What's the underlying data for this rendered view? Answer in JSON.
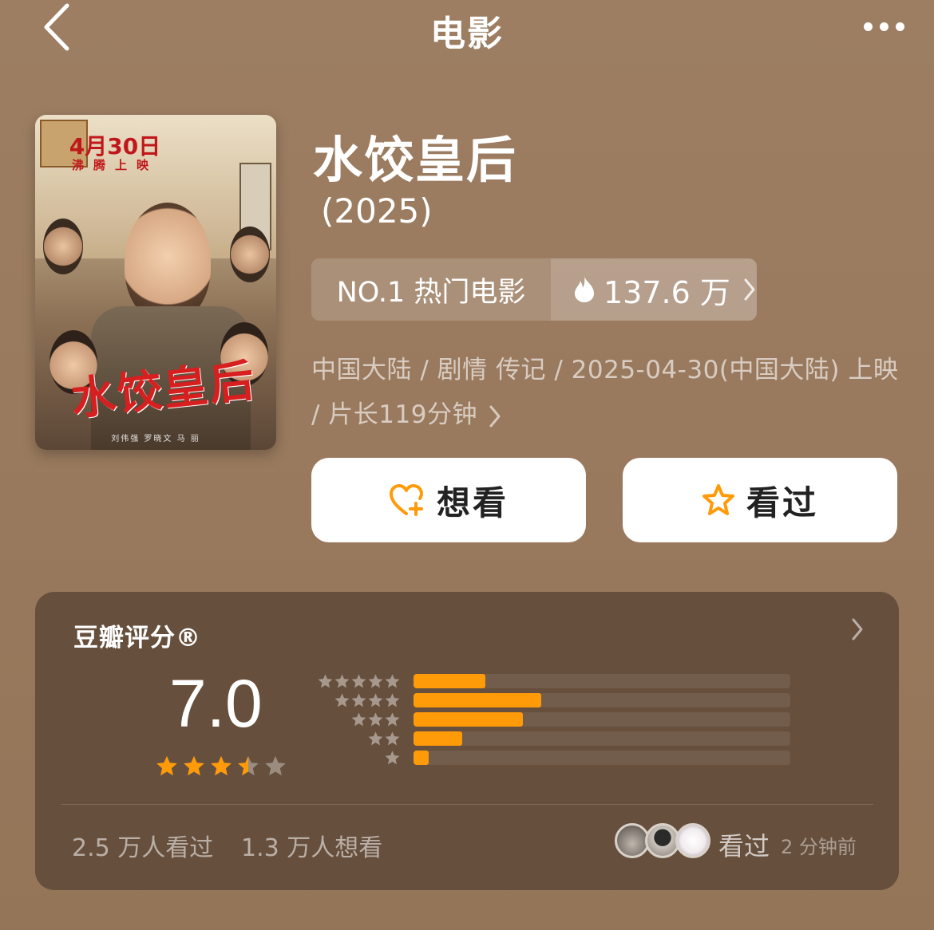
{
  "header": {
    "title": "电影"
  },
  "poster": {
    "date_text": "4月30日",
    "sub_text": "沸腾上映",
    "title_text": "水饺皇后",
    "credits_text": "刘伟强   罗晓文   马 丽"
  },
  "movie": {
    "title": "水饺皇后",
    "year": "(2025)",
    "rank_label": "NO.1 热门电影",
    "heat": "137.6 万",
    "meta_line": "中国大陆 / 剧情 传记 / 2025-04-30(中国大陆) 上映 / 片长119分钟"
  },
  "actions": {
    "want_label": "想看",
    "seen_label": "看过"
  },
  "rating": {
    "label": "豆瓣评分®",
    "score": "7.0",
    "stars": 3.5,
    "distribution": [
      {
        "stars": 5,
        "fraction": 0.19
      },
      {
        "stars": 4,
        "fraction": 0.34
      },
      {
        "stars": 3,
        "fraction": 0.29
      },
      {
        "stars": 2,
        "fraction": 0.13
      },
      {
        "stars": 1,
        "fraction": 0.04
      }
    ],
    "seen_count": "2.5 万人看过",
    "want_count": "1.3 万人想看",
    "friend_status": "看过",
    "friend_time": "2 分钟前"
  },
  "colors": {
    "accent": "#ff9a08",
    "card": "#664f3c",
    "background": "#9a7b61"
  }
}
